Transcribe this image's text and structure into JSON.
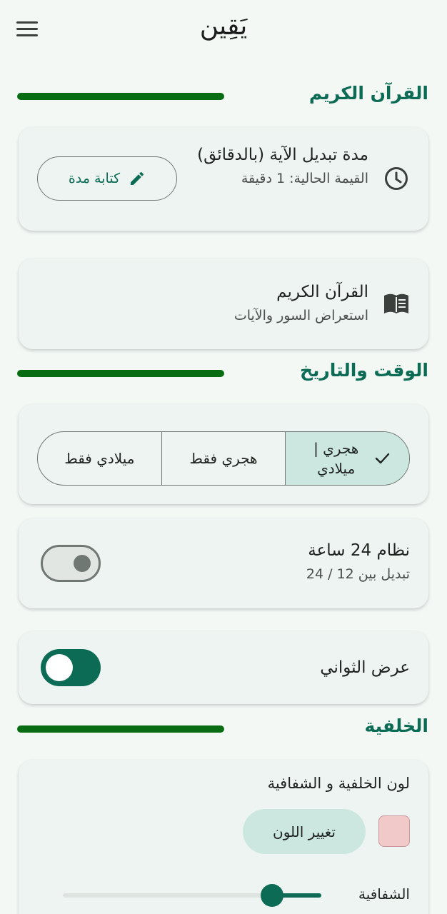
{
  "app": {
    "title": "يَقِين"
  },
  "quran_section": {
    "title": "القرآن الكريم"
  },
  "verse_interval": {
    "title": "مدة تبديل الآية (بالدقائق)",
    "current_value": "القيمة الحالية: 1 دقيقة",
    "button_label": "كتابة مدة",
    "icon": "clock-icon",
    "button_icon": "pencil-icon"
  },
  "quran_browse": {
    "title": "القرآن الكريم",
    "subtitle": "استعراض السور والآيات",
    "icon": "book-icon"
  },
  "time_section": {
    "title": "الوقت والتاريخ"
  },
  "date_mode": {
    "options": [
      "هجري | ميلادي",
      "هجري فقط",
      "ميلادي فقط"
    ],
    "selected": "هجري | ميلادي"
  },
  "clock_24h": {
    "title": "نظام 24 ساعة",
    "subtitle": "تبديل بين 12 / 24",
    "enabled": false
  },
  "show_seconds": {
    "title": "عرض الثواني",
    "enabled": true
  },
  "background_section": {
    "title": "الخلفية"
  },
  "background": {
    "title": "لون الخلفية و الشفافية",
    "change_color_label": "تغيير اللون",
    "swatch_color": "#f2c9c9",
    "opacity_label": "الشفافية",
    "opacity_value": 0.81
  },
  "colors": {
    "accent": "#0c6b55",
    "section_line": "#086d12"
  }
}
